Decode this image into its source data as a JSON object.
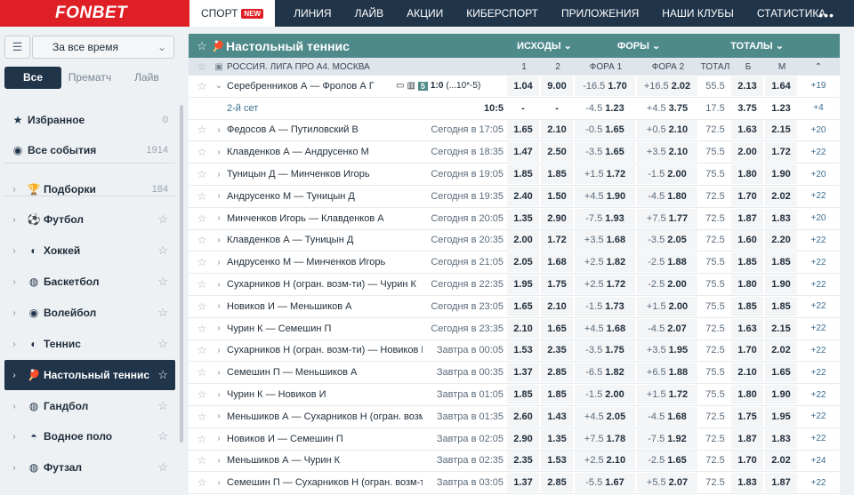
{
  "header": {
    "logo": "FONBET",
    "nav": [
      "СПОРТ",
      "ЛИНИЯ",
      "ЛАЙВ",
      "АКЦИИ",
      "КИБЕРСПОРТ",
      "ПРИЛОЖЕНИЯ",
      "НАШИ КЛУБЫ",
      "СТАТИСТИКА"
    ],
    "new_badge": "NEW",
    "more": "•••"
  },
  "sidebar": {
    "period": "За все время",
    "tabs": [
      "Все",
      "Прематч",
      "Лайв"
    ],
    "items": [
      {
        "label": "Избранное",
        "count": "0",
        "icon": "star-icon"
      },
      {
        "label": "Все события",
        "count": "1914",
        "icon": "globe-icon"
      },
      {
        "label": "Подборки",
        "count": "184",
        "icon": "trophy-icon"
      },
      {
        "label": "Футбол",
        "icon": "football-icon"
      },
      {
        "label": "Хоккей",
        "icon": "hockey-icon"
      },
      {
        "label": "Баскетбол",
        "icon": "basketball-icon"
      },
      {
        "label": "Волейбол",
        "icon": "volleyball-icon"
      },
      {
        "label": "Теннис",
        "icon": "tennis-icon"
      },
      {
        "label": "Настольный теннис",
        "icon": "table-tennis-icon"
      },
      {
        "label": "Гандбол",
        "icon": "handball-icon"
      },
      {
        "label": "Водное поло",
        "icon": "waterpolo-icon"
      },
      {
        "label": "Футзал",
        "icon": "futsal-icon"
      }
    ]
  },
  "main": {
    "sport_title": "Настольный теннис",
    "groups": [
      "ИСХОДЫ",
      "ФОРЫ",
      "ТОТАЛЫ"
    ],
    "league": "РОССИЯ. ЛИГА ПРО А4. МОСКВА",
    "cols": [
      "1",
      "2",
      "ФОРА 1",
      "ФОРА 2",
      "ТОТАЛ",
      "Б",
      "М"
    ],
    "live": {
      "name": "Серебренников А — Фролов А Г",
      "set": "5",
      "score": "1:0",
      "detail": "(...10*-5)",
      "o1": "1.04",
      "o2": "9.00",
      "h1": "-16.5",
      "h1o": "1.70",
      "h2": "+16.5",
      "h2o": "2.02",
      "tot": "55.5",
      "b": "2.13",
      "m": "1.64",
      "more": "+19"
    },
    "live_sub": {
      "name": "2-й сет",
      "score": "10:5",
      "o1": "-",
      "o2": "-",
      "h1": "-4.5",
      "h1o": "1.23",
      "h2": "+4.5",
      "h2o": "3.75",
      "tot": "17.5",
      "b": "3.75",
      "m": "1.23",
      "more": "+4"
    },
    "rows": [
      {
        "name": "Федосов А — Путиловский В",
        "time": "Сегодня в 17:05",
        "o1": "1.65",
        "o2": "2.10",
        "h1": "-0.5",
        "h1o": "1.65",
        "h2": "+0.5",
        "h2o": "2.10",
        "tot": "72.5",
        "b": "1.63",
        "m": "2.15",
        "more": "+20"
      },
      {
        "name": "Клавденков А — Андрусенко М",
        "time": "Сегодня в 18:35",
        "o1": "1.47",
        "o2": "2.50",
        "h1": "-3.5",
        "h1o": "1.65",
        "h2": "+3.5",
        "h2o": "2.10",
        "tot": "75.5",
        "b": "2.00",
        "m": "1.72",
        "more": "+22"
      },
      {
        "name": "Туницын Д — Минченков Игорь",
        "time": "Сегодня в 19:05",
        "o1": "1.85",
        "o2": "1.85",
        "h1": "+1.5",
        "h1o": "1.72",
        "h2": "-1.5",
        "h2o": "2.00",
        "tot": "75.5",
        "b": "1.80",
        "m": "1.90",
        "more": "+20"
      },
      {
        "name": "Андрусенко М — Туницын Д",
        "time": "Сегодня в 19:35",
        "o1": "2.40",
        "o2": "1.50",
        "h1": "+4.5",
        "h1o": "1.90",
        "h2": "-4.5",
        "h2o": "1.80",
        "tot": "72.5",
        "b": "1.70",
        "m": "2.02",
        "more": "+22"
      },
      {
        "name": "Минченков Игорь — Клавденков А",
        "time": "Сегодня в 20:05",
        "o1": "1.35",
        "o2": "2.90",
        "h1": "-7.5",
        "h1o": "1.93",
        "h2": "+7.5",
        "h2o": "1.77",
        "tot": "72.5",
        "b": "1.87",
        "m": "1.83",
        "more": "+20"
      },
      {
        "name": "Клавденков А — Туницын Д",
        "time": "Сегодня в 20:35",
        "o1": "2.00",
        "o2": "1.72",
        "h1": "+3.5",
        "h1o": "1.68",
        "h2": "-3.5",
        "h2o": "2.05",
        "tot": "72.5",
        "b": "1.60",
        "m": "2.20",
        "more": "+22"
      },
      {
        "name": "Андрусенко М — Минченков Игорь",
        "time": "Сегодня в 21:05",
        "o1": "2.05",
        "o2": "1.68",
        "h1": "+2.5",
        "h1o": "1.82",
        "h2": "-2.5",
        "h2o": "1.88",
        "tot": "75.5",
        "b": "1.85",
        "m": "1.85",
        "more": "+22"
      },
      {
        "name": "Сухарников Н (огран. возм-ти) — Чурин К",
        "time": "Сегодня в 22:35",
        "o1": "1.95",
        "o2": "1.75",
        "h1": "+2.5",
        "h1o": "1.72",
        "h2": "-2.5",
        "h2o": "2.00",
        "tot": "75.5",
        "b": "1.80",
        "m": "1.90",
        "more": "+22"
      },
      {
        "name": "Новиков И — Меньшиков А",
        "time": "Сегодня в 23:05",
        "o1": "1.65",
        "o2": "2.10",
        "h1": "-1.5",
        "h1o": "1.73",
        "h2": "+1.5",
        "h2o": "2.00",
        "tot": "75.5",
        "b": "1.85",
        "m": "1.85",
        "more": "+22"
      },
      {
        "name": "Чурин К — Семешин П",
        "time": "Сегодня в 23:35",
        "o1": "2.10",
        "o2": "1.65",
        "h1": "+4.5",
        "h1o": "1.68",
        "h2": "-4.5",
        "h2o": "2.07",
        "tot": "72.5",
        "b": "1.63",
        "m": "2.15",
        "more": "+22"
      },
      {
        "name": "Сухарников Н (огран. возм-ти) — Новиков И",
        "time": "Завтра в 00:05",
        "o1": "1.53",
        "o2": "2.35",
        "h1": "-3.5",
        "h1o": "1.75",
        "h2": "+3.5",
        "h2o": "1.95",
        "tot": "72.5",
        "b": "1.70",
        "m": "2.02",
        "more": "+22"
      },
      {
        "name": "Семешин П — Меньшиков А",
        "time": "Завтра в 00:35",
        "o1": "1.37",
        "o2": "2.85",
        "h1": "-6.5",
        "h1o": "1.82",
        "h2": "+6.5",
        "h2o": "1.88",
        "tot": "75.5",
        "b": "2.10",
        "m": "1.65",
        "more": "+22"
      },
      {
        "name": "Чурин К — Новиков И",
        "time": "Завтра в 01:05",
        "o1": "1.85",
        "o2": "1.85",
        "h1": "-1.5",
        "h1o": "2.00",
        "h2": "+1.5",
        "h2o": "1.72",
        "tot": "75.5",
        "b": "1.80",
        "m": "1.90",
        "more": "+22"
      },
      {
        "name": "Меньшиков А — Сухарников Н (огран. возм-ти)",
        "time": "Завтра в 01:35",
        "o1": "2.60",
        "o2": "1.43",
        "h1": "+4.5",
        "h1o": "2.05",
        "h2": "-4.5",
        "h2o": "1.68",
        "tot": "72.5",
        "b": "1.75",
        "m": "1.95",
        "more": "+22"
      },
      {
        "name": "Новиков И — Семешин П",
        "time": "Завтра в 02:05",
        "o1": "2.90",
        "o2": "1.35",
        "h1": "+7.5",
        "h1o": "1.78",
        "h2": "-7.5",
        "h2o": "1.92",
        "tot": "72.5",
        "b": "1.87",
        "m": "1.83",
        "more": "+22"
      },
      {
        "name": "Меньшиков А — Чурин К",
        "time": "Завтра в 02:35",
        "o1": "2.35",
        "o2": "1.53",
        "h1": "+2.5",
        "h1o": "2.10",
        "h2": "-2.5",
        "h2o": "1.65",
        "tot": "72.5",
        "b": "1.70",
        "m": "2.02",
        "more": "+24"
      },
      {
        "name": "Семешин П — Сухарников Н (огран. возм-ти)",
        "time": "Завтра в 03:05",
        "o1": "1.37",
        "o2": "2.85",
        "h1": "-5.5",
        "h1o": "1.67",
        "h2": "+5.5",
        "h2o": "2.07",
        "tot": "72.5",
        "b": "1.83",
        "m": "1.87",
        "more": "+22"
      }
    ]
  }
}
